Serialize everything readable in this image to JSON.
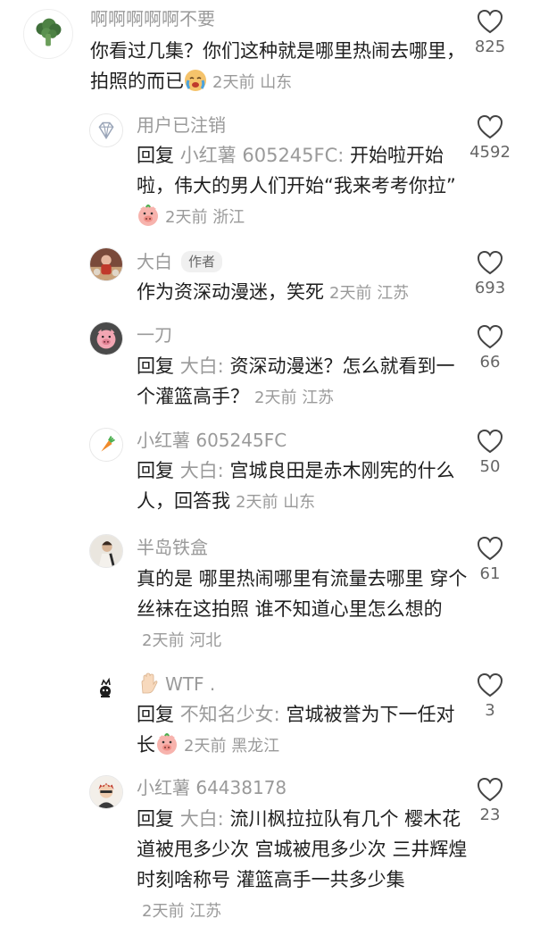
{
  "comments": [
    {
      "username": "啊啊啊啊啊不要",
      "text": "你看过几集？你们这种就是哪里热闹去哪里，拍照的而已",
      "time": "2天前",
      "location": "山东",
      "likes": "825",
      "avatar": "broccoli-avatar",
      "emoji": "crying-face"
    },
    {
      "username": "用户已注销",
      "reply_word": "回复",
      "reply_to": "小红薯 605245FC:",
      "text": "开始啦开始啦，伟大的男人们开始“我来考考你拉”",
      "time": "2天前",
      "location": "浙江",
      "likes": "4592",
      "avatar": "diamond-avatar",
      "emoji": "pig-face"
    },
    {
      "username": "大白",
      "tag": "作者",
      "text": "作为资深动漫迷，笑死",
      "time": "2天前",
      "location": "江苏",
      "likes": "693",
      "avatar": "photo-avatar"
    },
    {
      "username": "一刀",
      "reply_word": "回复",
      "reply_to": "大白:",
      "text": "资深动漫迷？怎么就看到一个灌篮高手？",
      "time": "2天前",
      "location": "江苏",
      "likes": "66",
      "avatar": "pig-avatar"
    },
    {
      "username": "小红薯 605245FC",
      "reply_word": "回复",
      "reply_to": "大白:",
      "text": "宫城良田是赤木刚宪的什么人，回答我",
      "time": "2天前",
      "location": "山东",
      "likes": "50",
      "avatar": "carrot-avatar"
    },
    {
      "username": "半岛铁盒",
      "text": "真的是 哪里热闹哪里有流量去哪里 穿个丝袜在这拍照 谁不知道心里怎么想的",
      "time": "2天前",
      "location": "河北",
      "likes": "61",
      "avatar": "person-avatar"
    },
    {
      "username": "WTF .",
      "reply_word": "回复",
      "reply_to": "不知名少女:",
      "text": "宫城被誉为下一任对长",
      "time": "2天前",
      "location": "黑龙江",
      "likes": "3",
      "avatar": "cartoon-avatar",
      "emoji": "pig-face"
    },
    {
      "username": "小红薯 64438178",
      "reply_word": "回复",
      "reply_to": "大白:",
      "text": "流川枫拉拉队有几个 樱木花道被甩多少次 宫城被甩多少次 三井辉煌时刻啥称号 灌篮高手一共多少集",
      "time": "2天前",
      "location": "江苏",
      "likes": "23",
      "avatar": "anime-avatar"
    }
  ]
}
